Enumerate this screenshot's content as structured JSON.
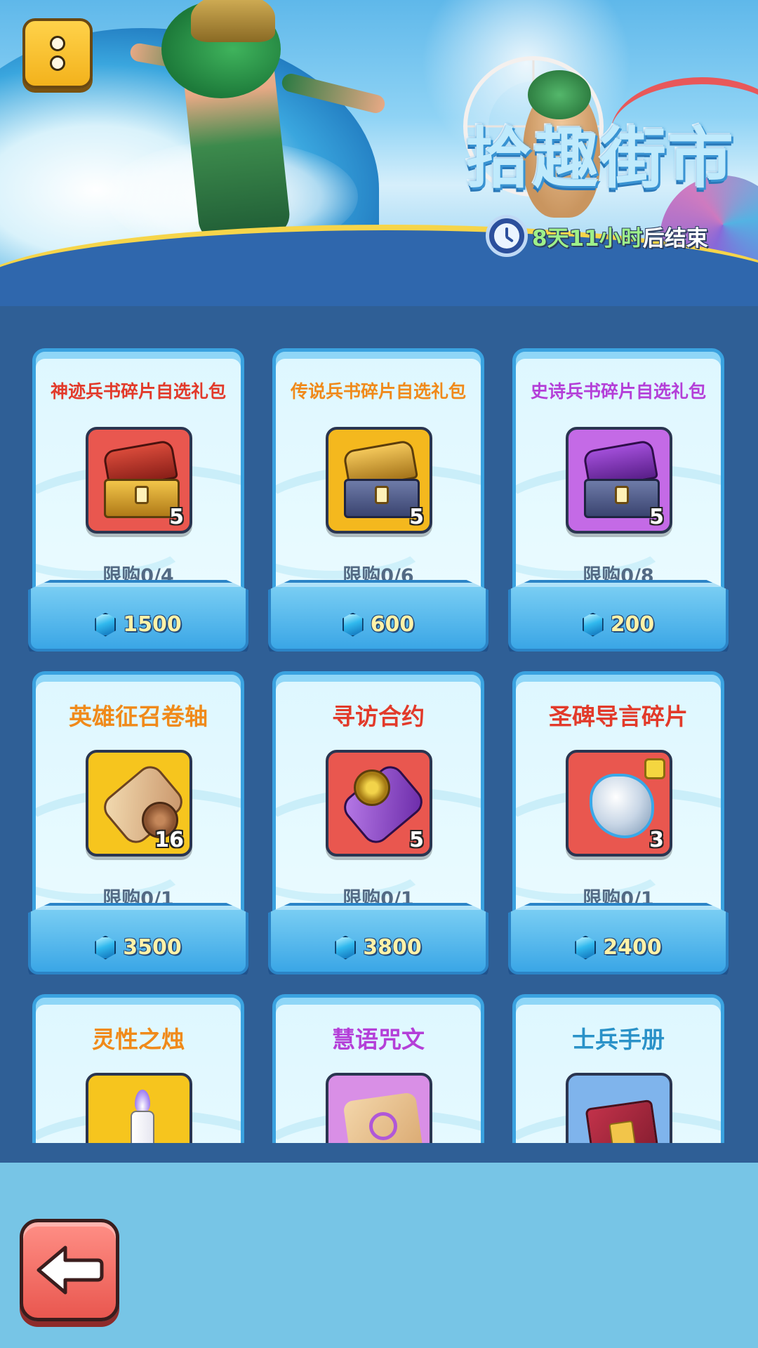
{
  "banner": {
    "title": "拾趣街市",
    "timer": {
      "highlight": "8天11小时",
      "suffix": "后结束"
    }
  },
  "menu_button": {
    "icon": "menu-dots-icon"
  },
  "back_button": {
    "icon": "arrow-left-icon"
  },
  "items": [
    {
      "name": "神迹兵书碎片自选礼包",
      "name_color": "#e23a2a",
      "qty": "5",
      "limit": "限购0/4",
      "price": "1500",
      "icon": "red-chest-icon",
      "bg": "#e9574f"
    },
    {
      "name": "传说兵书碎片自选礼包",
      "name_color": "#f08a1a",
      "qty": "5",
      "limit": "限购0/6",
      "price": "600",
      "icon": "gold-chest-icon",
      "bg": "#f4b81e"
    },
    {
      "name": "史诗兵书碎片自选礼包",
      "name_color": "#b43fd8",
      "qty": "5",
      "limit": "限购0/8",
      "price": "200",
      "icon": "purple-chest-icon",
      "bg": "#c46ae6"
    },
    {
      "name": "英雄征召卷轴",
      "name_color": "#f08a1a",
      "qty": "16",
      "limit": "限购0/1",
      "price": "3500",
      "icon": "scroll-icon",
      "bg": "#f6c51e"
    },
    {
      "name": "寻访合约",
      "name_color": "#e23a2a",
      "qty": "5",
      "limit": "限购0/1",
      "price": "3800",
      "icon": "contract-scroll-icon",
      "bg": "#e9574f"
    },
    {
      "name": "圣碑导言碎片",
      "name_color": "#e23a2a",
      "qty": "3",
      "limit": "限购0/1",
      "price": "2400",
      "icon": "rune-stone-icon",
      "bg": "#e9574f"
    },
    {
      "name": "灵性之烛",
      "name_color": "#f08a1a",
      "qty": "",
      "limit": "",
      "price": "",
      "icon": "candle-icon",
      "bg": "#f6c51e"
    },
    {
      "name": "慧语咒文",
      "name_color": "#b43fd8",
      "qty": "",
      "limit": "",
      "price": "",
      "icon": "spell-scroll-icon",
      "bg": "#d98fe6"
    },
    {
      "name": "士兵手册",
      "name_color": "#2a92c8",
      "qty": "",
      "limit": "",
      "price": "",
      "icon": "manual-book-icon",
      "bg": "#7fb4ec"
    }
  ]
}
